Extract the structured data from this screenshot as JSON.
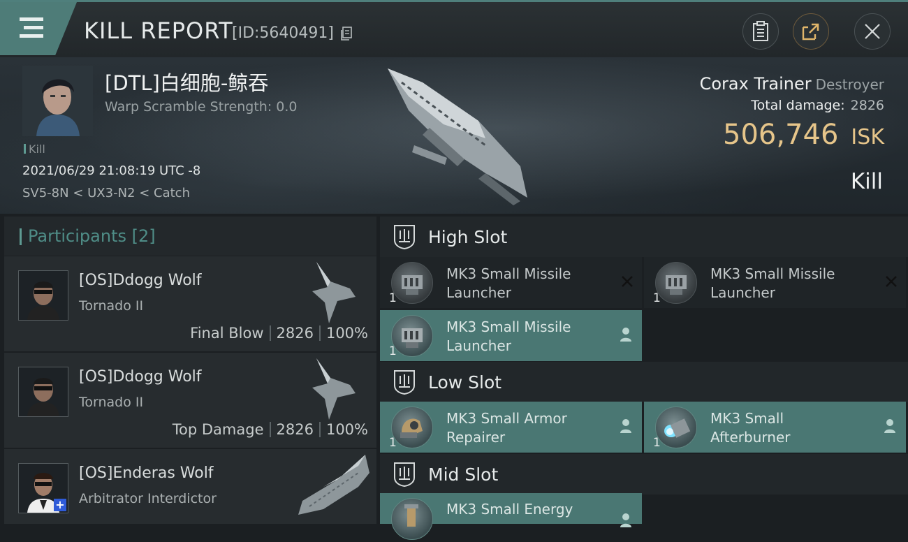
{
  "topbar": {
    "title": "KILL REPORT",
    "report_id": "[ID:5640491]",
    "icons": [
      "menu-icon",
      "copy-icon",
      "clipboard-icon",
      "share-icon",
      "close-icon"
    ]
  },
  "victim": {
    "name": "[DTL]白细胞-鲸吞",
    "warp_scramble": "Warp Scramble Strength: 0.0",
    "tag": "Kill",
    "datetime": "2021/06/29 21:08:19 UTC -8",
    "location": "SV5-8N < UX3-N2 < Catch",
    "ship_name": "Corax Trainer",
    "ship_class": "Destroyer",
    "total_damage_label": "Total damage:",
    "total_damage": "2826",
    "isk_value": "506,746",
    "isk_unit": "ISK",
    "result": "Kill"
  },
  "participants": {
    "label": "Participants",
    "count": "[2]",
    "rows": [
      {
        "name": "[OS]Ddogg Wolf",
        "ship": "Tornado II",
        "role": "Final Blow",
        "damage": "2826",
        "percent": "100%"
      },
      {
        "name": "[OS]Ddogg Wolf",
        "ship": "Tornado II",
        "role": "Top Damage",
        "damage": "2826",
        "percent": "100%"
      },
      {
        "name": "[OS]Enderas Wolf",
        "ship": "Arbitrator Interdictor",
        "role": "",
        "damage": "",
        "percent": ""
      }
    ]
  },
  "slots": {
    "high": {
      "label": "High Slot",
      "modules": [
        {
          "qty": "1",
          "name_line1": "MK3 Small Missile",
          "name_line2": "Launcher",
          "state": "destroyed"
        },
        {
          "qty": "1",
          "name_line1": "MK3 Small Missile",
          "name_line2": "Launcher",
          "state": "destroyed"
        },
        {
          "qty": "1",
          "name_line1": "MK3 Small Missile",
          "name_line2": "Launcher",
          "state": "dropped"
        }
      ]
    },
    "low": {
      "label": "Low Slot",
      "modules": [
        {
          "qty": "1",
          "name_line1": "MK3 Small Armor",
          "name_line2": "Repairer",
          "state": "dropped"
        },
        {
          "qty": "1",
          "name_line1": "MK3 Small",
          "name_line2": "Afterburner",
          "state": "dropped"
        }
      ]
    },
    "mid": {
      "label": "Mid Slot",
      "modules": [
        {
          "qty": "1",
          "name_line1": "MK3 Small Energy",
          "name_line2": "",
          "state": "dropped"
        }
      ]
    }
  },
  "colors": {
    "accent_teal": "#4e7c78",
    "isk_gold": "#e6c58a",
    "dropped_bg": "#4a7773",
    "destroyed_bg": "#1f2427"
  }
}
